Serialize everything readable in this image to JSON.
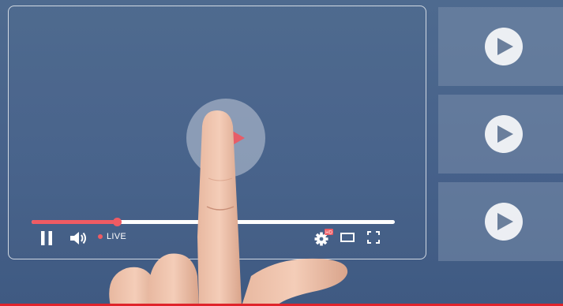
{
  "player": {
    "live_label": "LIVE",
    "progress_fraction": 0.235,
    "hd_badge": "HD",
    "icons": {
      "big_play": "play-icon",
      "pause": "pause-icon",
      "volume": "volume-icon",
      "settings": "gear-icon",
      "theater": "theater-mode-icon",
      "fullscreen": "fullscreen-icon"
    }
  },
  "sidebar": {
    "thumbnails": [
      {
        "icon": "play-icon"
      },
      {
        "icon": "play-icon"
      },
      {
        "icon": "play-icon"
      }
    ]
  },
  "colors": {
    "accent": "#ef5b63",
    "background": "#46618a",
    "control": "#ffffff",
    "bottom_strip": "#e0242b"
  }
}
